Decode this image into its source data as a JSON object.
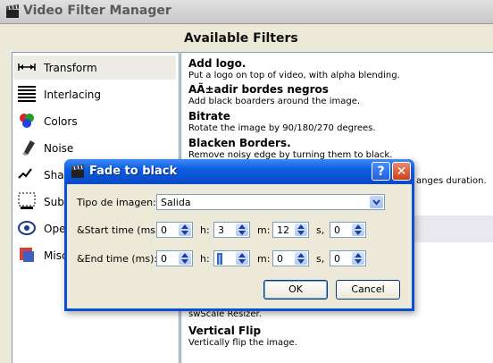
{
  "window": {
    "title": "Video Filter Manager"
  },
  "filters_header": "Available Filters",
  "categories": [
    {
      "label": "Transform",
      "icon": "transform-icon"
    },
    {
      "label": "Interlacing",
      "icon": "interlacing-icon"
    },
    {
      "label": "Colors",
      "icon": "colors-icon"
    },
    {
      "label": "Noise",
      "icon": "noise-icon"
    },
    {
      "label": "Sharp",
      "icon": "sharpness-icon"
    },
    {
      "label": "Subti",
      "icon": "subtitles-icon"
    },
    {
      "label": "Open",
      "icon": "opengl-icon"
    },
    {
      "label": "Misce",
      "icon": "misc-icon"
    }
  ],
  "filters": [
    {
      "name": "Add logo.",
      "desc": "Put a logo on top of video, with alpha blending."
    },
    {
      "name": "AÃ±adir bordes negros",
      "desc": "Add black boarders around the image."
    },
    {
      "name": "Bitrate",
      "desc": "Rotate the image by 90/180/270 degrees."
    },
    {
      "name": "Blacken Borders.",
      "desc": "Remove noisy edge by turning them to black."
    },
    {
      "name": "",
      "desc": "anges duration."
    },
    {
      "name": "",
      "desc": "swScale Resizer."
    },
    {
      "name": "Vertical Flip",
      "desc": "Vertically flip the image."
    }
  ],
  "dialog": {
    "title": "Fade to black",
    "help_label": "?",
    "close_label": "✕",
    "image_type_label": "Tipo de imagen:",
    "image_type_value": "Salida",
    "start_label": "&Start time (ms):",
    "end_label": "&End time (ms):",
    "unit_h": "h:",
    "unit_m": "m:",
    "unit_s": "s,",
    "start": {
      "h": "0",
      "m": "3",
      "s": "12",
      "ms": "0"
    },
    "end": {
      "h": "0",
      "m": "0",
      "s": "0",
      "ms": "0"
    },
    "end_m_cursor": "|",
    "ok_label": "OK",
    "cancel_label": "Cancel"
  },
  "colors": {
    "titlebar_blue": "#0d5de0",
    "selection": "#316ac5",
    "close_red": "#c8401c"
  }
}
